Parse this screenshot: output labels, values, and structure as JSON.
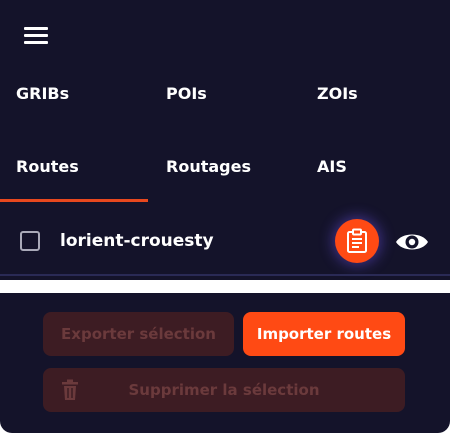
{
  "colors": {
    "panel_bg": "#14132a",
    "accent": "#ff4a14",
    "disabled_bg": "#3d1c23",
    "disabled_text": "#6b3a3c"
  },
  "menu": {
    "icon": "hamburger-menu-icon"
  },
  "tabs_row1": [
    {
      "label": "GRIBs"
    },
    {
      "label": "POIs"
    },
    {
      "label": "ZOIs"
    }
  ],
  "tabs_row2": [
    {
      "label": "Routes",
      "active": true
    },
    {
      "label": "Routages"
    },
    {
      "label": "AIS"
    }
  ],
  "routes": [
    {
      "name": "lorient-crouesty",
      "checked": false,
      "actions": [
        "clipboard-icon",
        "eye-icon"
      ]
    }
  ],
  "actions": {
    "export_label": "Exporter sélection",
    "export_enabled": false,
    "import_label": "Importer routes",
    "delete_label": "Supprimer la sélection",
    "delete_enabled": false,
    "delete_icon": "trash-icon"
  }
}
